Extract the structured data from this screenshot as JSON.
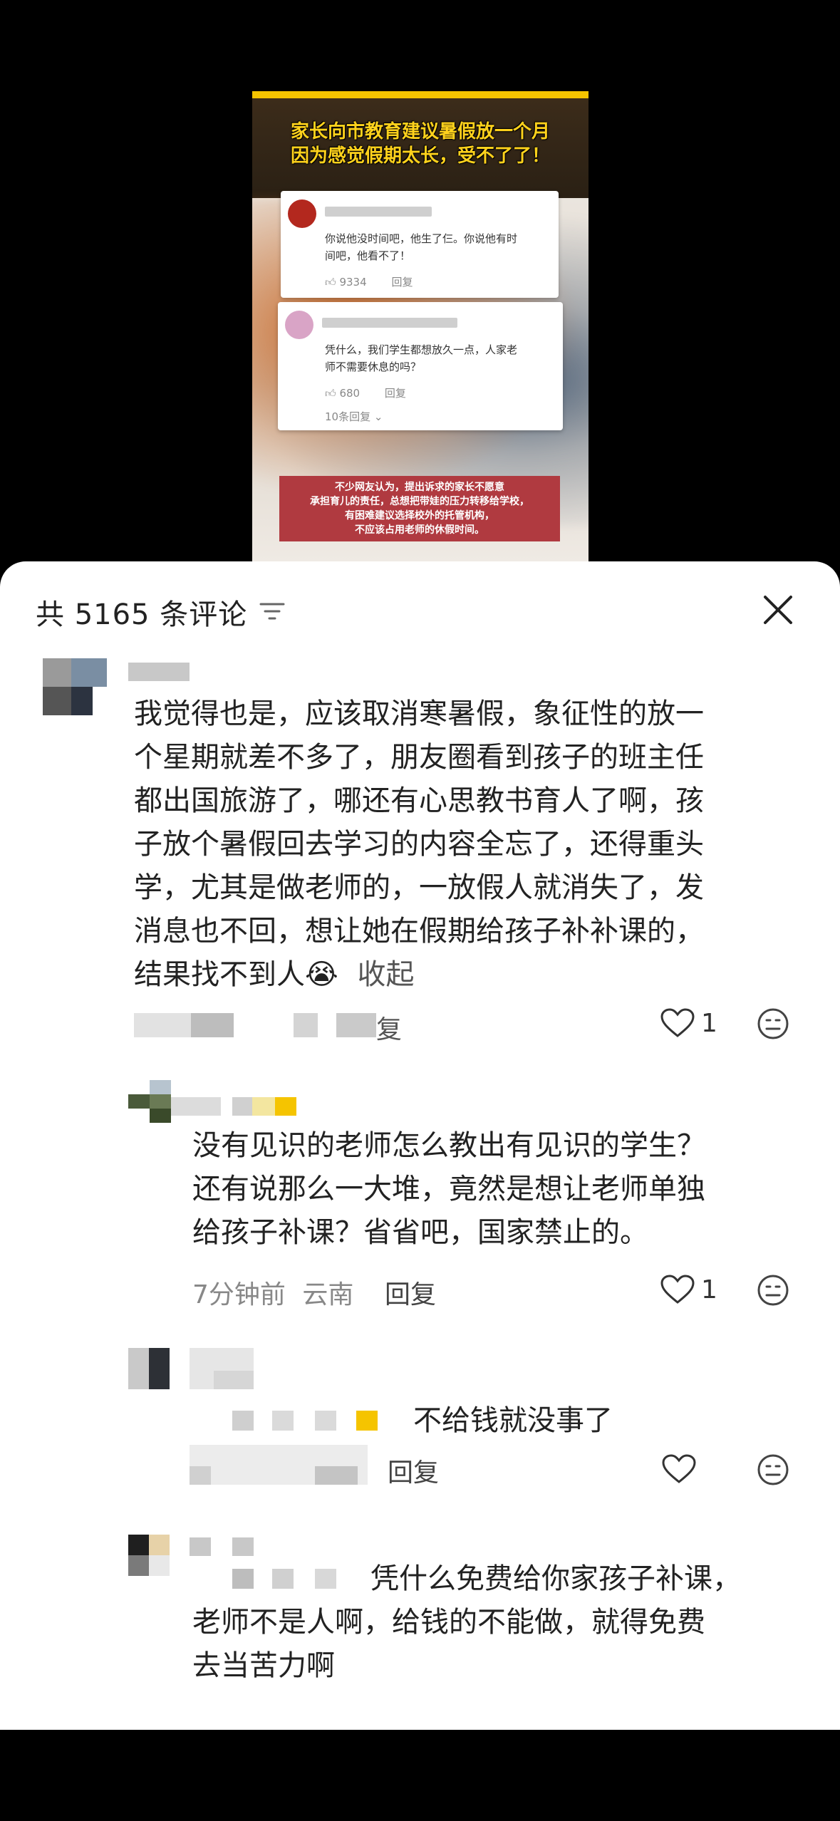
{
  "preview": {
    "headline_line1": "家长向市教育建议暑假放一个月",
    "headline_line2": "因为感觉假期太长，受不了了！",
    "card1": {
      "text_line1": "你说他没时间吧，他生了仨。你说他有时",
      "text_line2": "间吧，他看不了！",
      "likes": "9334",
      "reply": "回复"
    },
    "card2": {
      "text_line1": "凭什么，我们学生都想放久一点，人家老",
      "text_line2": "师不需要休息的吗？",
      "likes": "680",
      "reply": "回复",
      "more_replies": "10条回复 ⌄"
    },
    "banner_lines": [
      "不少网友认为，提出诉求的家长不愿意",
      "承担育儿的责任，总想把带娃的压力转移给学校，",
      "有困难建议选择校外的托管机构，",
      "不应该占用老师的休假时间。"
    ]
  },
  "sheet": {
    "title": "共 5165 条评论",
    "filter_icon": "filter-icon",
    "close_icon": "close-icon",
    "accent_color": "#f5c400"
  },
  "comments": [
    {
      "lines": [
        "我觉得也是，应该取消寒暑假，象征性的放一",
        "个星期就差不多了，朋友圈看到孩子的班主任",
        "都出国旅游了，哪还有心思教书育人了啊，孩",
        "子放个暑假回去学习的内容全忘了，还得重头",
        "学，尤其是做老师的，一放假人就消失了，发",
        "消息也不回，想让她在假期给孩子补补课的，",
        "结果找不到人"
      ],
      "emoji": "😭",
      "collapse": "收起",
      "reply": "复",
      "likes": "1"
    },
    {
      "lines": [
        "没有见识的老师怎么教出有见识的学生？",
        "还有说那么一大堆，竟然是想让老师单独",
        "给孩子补课？省省吧，国家禁止的。"
      ],
      "time": "7分钟前",
      "location": "云南",
      "reply": "回复",
      "likes": "1"
    },
    {
      "text": "不给钱就没事了",
      "reply": "回复",
      "likes": ""
    },
    {
      "lines": [
        "凭什么免费给你家孩子补课，",
        "老师不是人啊，给钱的不能做，就得免费",
        "去当苦力啊"
      ]
    }
  ]
}
